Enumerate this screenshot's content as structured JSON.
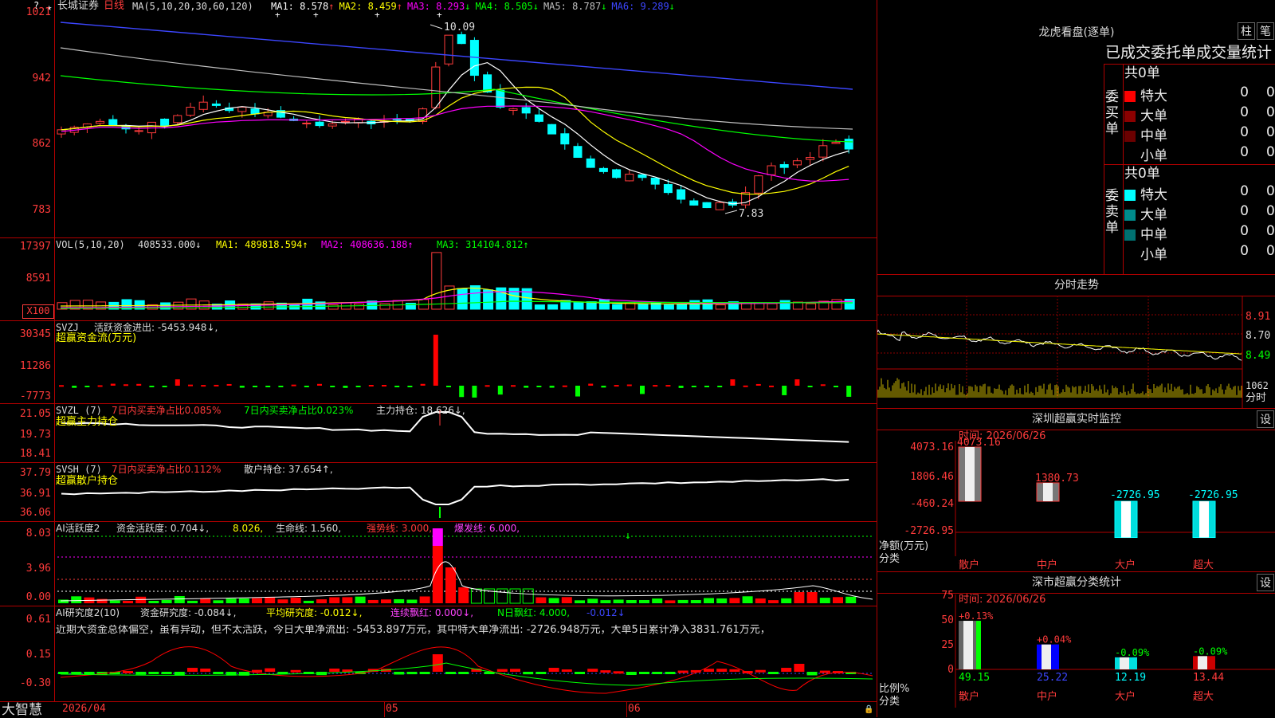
{
  "stock": {
    "name": "长城证券",
    "period": "日线",
    "ma_params": "MA(5,10,20,30,60,120)",
    "ma_values": [
      {
        "label": "MA1:",
        "value": "8.578",
        "arrow": "↑",
        "color": "#ffffff"
      },
      {
        "label": "MA2:",
        "value": "8.459",
        "arrow": "↑",
        "color": "#ffff00"
      },
      {
        "label": "MA3:",
        "value": "8.293",
        "arrow": "↓",
        "color": "#ff00ff"
      },
      {
        "label": "MA4:",
        "value": "8.505",
        "arrow": "↓",
        "color": "#00ff00"
      },
      {
        "label": "MA5:",
        "value": "8.787",
        "arrow": "↓",
        "color": "#c0c0c0"
      },
      {
        "label": "MA6:",
        "value": "9.289",
        "arrow": "↓",
        "color": "#3c46ff"
      }
    ],
    "yaxis": [
      "1021",
      "942",
      "862",
      "783"
    ],
    "high_label": "10.09",
    "low_label": "7.83"
  },
  "vol": {
    "params": "VOL(5,10,20)",
    "value": "408533.000↓",
    "ma1": "MA1: 489818.594↑",
    "ma2": "MA2: 408636.188↑",
    "ma3": "MA3: 314104.812↑",
    "yaxis": [
      "17397",
      "8591"
    ],
    "unit": "X100"
  },
  "svzj": {
    "name": "SVZJ",
    "title": "活跃资金进出: -5453.948↓,",
    "subtitle": "超赢资金流(万元)",
    "yaxis": [
      "30345",
      "11286",
      "-7773"
    ]
  },
  "svzl": {
    "name": "SVZL (7)",
    "t1": "7日内买卖净占比0.085%",
    "t2": "7日内买卖净占比0.023%",
    "t3": "主力持仓: 18.626↓,",
    "subtitle": "超赢主力持仓",
    "yaxis": [
      "21.05",
      "19.73",
      "18.41"
    ]
  },
  "svsh": {
    "name": "SVSH (7)",
    "t1": "7日内买卖净占比0.112%",
    "t2": "散户持仓: 37.654↑,",
    "subtitle": "超赢散户持仓",
    "yaxis": [
      "37.79",
      "36.91",
      "36.06"
    ]
  },
  "ai1": {
    "name": "AI活跃度2",
    "t1": "资金活跃度: 0.704↓,",
    "t2": "8.026,",
    "t3": "生命线: 1.560,",
    "t4": "强势线: 3.000,",
    "t5": "爆发线: 6.000,",
    "yaxis": [
      "8.03",
      "3.96",
      "0.00"
    ]
  },
  "ai2": {
    "name": "AI研究度2(10)",
    "t1": "资金研究度: -0.084↓,",
    "t2": "平均研究度: -0.012↓,",
    "t3": "连续飘红: 0.000↓,",
    "t4": "N日飘红: 4.000,",
    "t5": "-0.012↓",
    "note": "近期大资金总体偏空，虽有异动，但不太活跃，今日大单净流出: -5453.897万元，其中特大单净流出: -2726.948万元，大单5日累计净入3831.761万元，",
    "yaxis": [
      "0.61",
      "0.15",
      "-0.30"
    ]
  },
  "xaxis": {
    "brand": "大智慧",
    "date": "2026/04",
    "m1": "05",
    "m2": "06"
  },
  "lhb": {
    "title": "龙虎看盘(逐单)",
    "btn1": "柱",
    "btn2": "笔",
    "subtitle": "已成交委托单成交量统计",
    "buy_label": "委买单",
    "sell_label": "委卖单",
    "buy_total": "共0单",
    "sell_total": "共0单",
    "buy_rows": [
      {
        "name": "特大",
        "n": "0",
        "p": "0%",
        "color": "#ff0000"
      },
      {
        "name": "大单",
        "n": "0",
        "p": "0%",
        "color": "#8b0000"
      },
      {
        "name": "中单",
        "n": "0",
        "p": "0%",
        "color": "#6b0000"
      },
      {
        "name": "小单",
        "n": "0",
        "p": "0%",
        "color": ""
      }
    ],
    "sell_rows": [
      {
        "name": "特大",
        "n": "0",
        "p": "0%",
        "color": "#00ffff"
      },
      {
        "name": "大单",
        "n": "0",
        "p": "0%",
        "color": "#008b8b"
      },
      {
        "name": "中单",
        "n": "0",
        "p": "0%",
        "color": "#007070"
      },
      {
        "name": "小单",
        "n": "0",
        "p": "0%",
        "color": ""
      }
    ]
  },
  "intraday": {
    "title": "分时走势",
    "yaxis": [
      "8.91",
      "8.70",
      "8.49"
    ],
    "vol_label": "1062",
    "footer": "分时"
  },
  "sz_monitor": {
    "title": "深圳超赢实时监控",
    "btn": "设",
    "time": "时间: 2026/06/26",
    "yaxis": [
      "4073.16",
      "1806.46",
      "-460.24",
      "-2726.95"
    ],
    "ylabel": "净额(万元)",
    "xlabel": "分类",
    "bars": [
      {
        "cat": "散户",
        "value": "4073.16"
      },
      {
        "cat": "中户",
        "value": "1380.73"
      },
      {
        "cat": "大户",
        "value": "-2726.95"
      },
      {
        "cat": "超大",
        "value": "-2726.95"
      }
    ]
  },
  "sz_stats": {
    "title": "深市超赢分类统计",
    "btn": "设",
    "time": "时间: 2026/06/26",
    "yaxis": [
      "75",
      "50",
      "25",
      "0"
    ],
    "ylabel": "比例%",
    "xlabel": "分类",
    "bars": [
      {
        "cat": "散户",
        "pct": "+0.13%",
        "value": "49.15"
      },
      {
        "cat": "中户",
        "pct": "+0.04%",
        "value": "25.22"
      },
      {
        "cat": "大户",
        "pct": "-0.09%",
        "value": "12.19"
      },
      {
        "cat": "超大",
        "pct": "-0.09%",
        "value": "13.44"
      }
    ]
  }
}
